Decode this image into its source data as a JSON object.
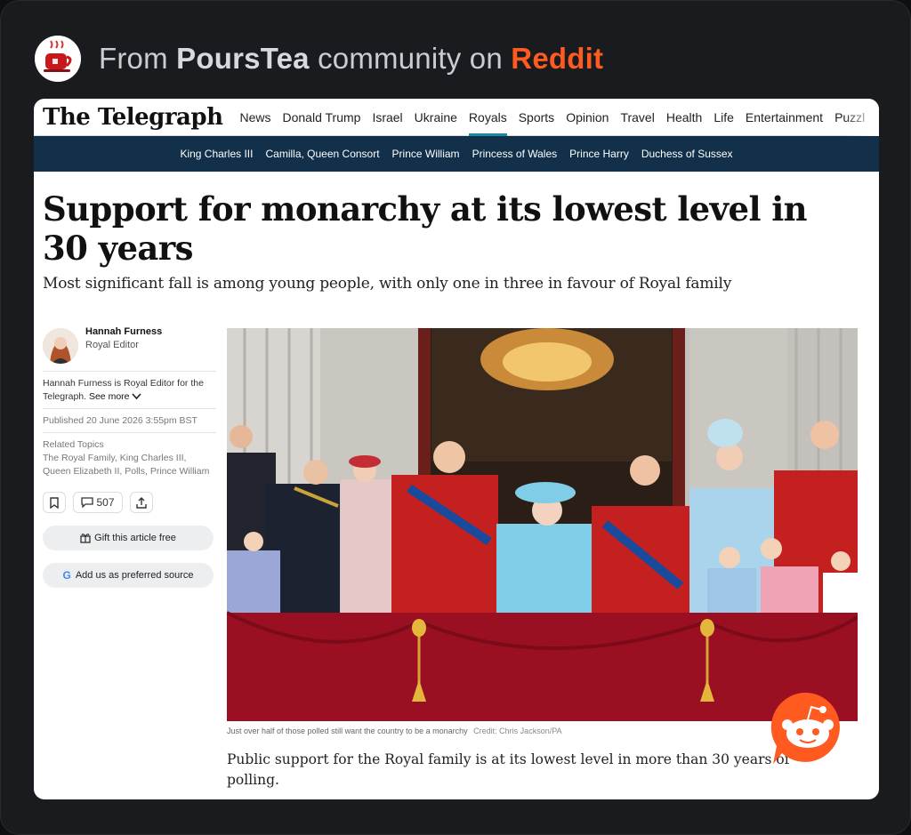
{
  "community": {
    "prefix": "From",
    "name": "PoursTea",
    "middle": "community on",
    "platform": "Reddit"
  },
  "site": {
    "logo": "The Telegraph",
    "nav": [
      "News",
      "Donald Trump",
      "Israel",
      "Ukraine",
      "Royals",
      "Sports",
      "Opinion",
      "Travel",
      "Health",
      "Life",
      "Entertainment",
      "Puzzl"
    ],
    "active_nav": "Royals",
    "subnav": [
      "King Charles III",
      "Camilla, Queen Consort",
      "Prince William",
      "Princess of Wales",
      "Prince Harry",
      "Duchess of Sussex"
    ]
  },
  "article": {
    "headline": "Support for monarchy at its lowest level in 30 years",
    "standfirst": "Most significant fall is among young people, with only one in three in favour of Royal family",
    "author": {
      "name": "Hannah Furness",
      "role": "Royal Editor",
      "bio": "Hannah Furness is Royal Editor for the Telegraph.",
      "see_more": "See more"
    },
    "published": "Published 20 June 2026 3:55pm BST",
    "related_title": "Related Topics",
    "related_topics": "The Royal Family, King Charles III, Queen Elizabeth II, Polls, Prince William",
    "comment_count": "507",
    "gift_label": "Gift this article free",
    "preferred_label": "Add us as preferred source",
    "caption": "Just over half of those polled still want the country to be a monarchy",
    "credit": "Credit: Chris Jackson/PA",
    "body": "Public support for the Royal family is at its lowest level in more than 30 years of polling."
  },
  "colors": {
    "reddit_orange": "#ff5a1f",
    "subnav_bg": "#12304a",
    "royals_underline": "#1a8aa5",
    "balcony_red": "#9a1022"
  },
  "icons": [
    "teacup-icon",
    "bookmark-icon",
    "comment-icon",
    "share-icon",
    "gift-icon",
    "google-icon",
    "chevron-down-icon",
    "reddit-snoo-icon"
  ]
}
